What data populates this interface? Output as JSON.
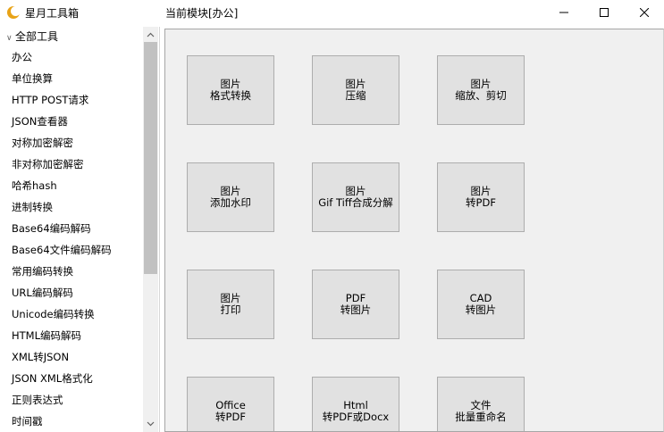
{
  "window": {
    "app_title": "星月工具箱",
    "module_label": "当前模块[办公]",
    "accent": "#e8a317"
  },
  "sidebar": {
    "root_label": "全部工具",
    "items": [
      "办公",
      "单位换算",
      "HTTP POST请求",
      "JSON查看器",
      "对称加密解密",
      "非对称加密解密",
      "哈希hash",
      "进制转换",
      "Base64编码解码",
      "Base64文件编码解码",
      "常用编码转换",
      "URL编码解码",
      "Unicode编码转换",
      "HTML编码解码",
      "XML转JSON",
      "JSON XML格式化",
      "正则表达式",
      "时间戳"
    ]
  },
  "tiles": [
    {
      "line1": "图片",
      "line2": "格式转换"
    },
    {
      "line1": "图片",
      "line2": "压缩"
    },
    {
      "line1": "图片",
      "line2": "缩放、剪切"
    },
    {
      "line1": "图片",
      "line2": "添加水印"
    },
    {
      "line1": "图片",
      "line2": "Gif Tiff合成分解"
    },
    {
      "line1": "图片",
      "line2": "转PDF"
    },
    {
      "line1": "图片",
      "line2": "打印"
    },
    {
      "line1": "PDF",
      "line2": "转图片"
    },
    {
      "line1": "CAD",
      "line2": "转图片"
    },
    {
      "line1": "Office",
      "line2": "转PDF"
    },
    {
      "line1": "Html",
      "line2": "转PDF或Docx"
    },
    {
      "line1": "文件",
      "line2": "批量重命名"
    }
  ]
}
